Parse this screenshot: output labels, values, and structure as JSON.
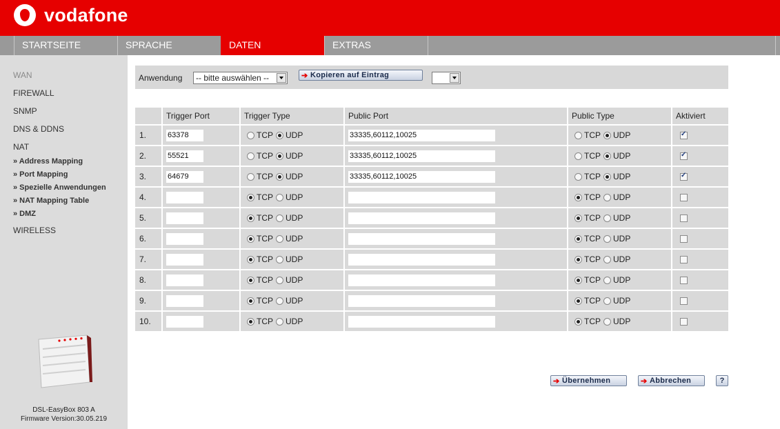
{
  "brand": {
    "name": "vodafone",
    "color": "#e60000"
  },
  "nav": {
    "items": [
      {
        "label": "STARTSEITE",
        "active": false
      },
      {
        "label": "SPRACHE",
        "active": false
      },
      {
        "label": "DATEN",
        "active": true
      },
      {
        "label": "EXTRAS",
        "active": false
      }
    ]
  },
  "sidebar": {
    "items": {
      "wan": "WAN",
      "firewall": "FIREWALL",
      "snmp": "SNMP",
      "dns": "DNS & DDNS",
      "nat": "NAT",
      "wireless": "WIRELESS"
    },
    "nat_sub": {
      "address_mapping": "» Address Mapping",
      "port_mapping": "» Port Mapping",
      "special_apps": "» Spezielle Anwendungen",
      "nat_table": "» NAT Mapping Table",
      "dmz": "» DMZ"
    },
    "device_name": "DSL-EasyBox 803 A",
    "firmware": "Firmware Version:30.05.219"
  },
  "toolbar": {
    "label": "Anwendung",
    "app_select_value": "-- bitte auswählen --",
    "copy_button": "Kopieren auf Eintrag",
    "entry_select_value": ""
  },
  "table": {
    "headers": {
      "num": "",
      "trigger_port": "Trigger Port",
      "trigger_type": "Trigger Type",
      "public_port": "Public Port",
      "public_type": "Public Type",
      "enabled": "Aktiviert"
    },
    "tcp_label": "TCP",
    "udp_label": "UDP",
    "rows": [
      {
        "num": "1.",
        "trigger_port": "63378",
        "trigger_type": "UDP",
        "public_port": "33335,60112,10025",
        "public_type": "UDP",
        "enabled": true
      },
      {
        "num": "2.",
        "trigger_port": "55521",
        "trigger_type": "UDP",
        "public_port": "33335,60112,10025",
        "public_type": "UDP",
        "enabled": true
      },
      {
        "num": "3.",
        "trigger_port": "64679",
        "trigger_type": "UDP",
        "public_port": "33335,60112,10025",
        "public_type": "UDP",
        "enabled": true
      },
      {
        "num": "4.",
        "trigger_port": "",
        "trigger_type": "TCP",
        "public_port": "",
        "public_type": "TCP",
        "enabled": false
      },
      {
        "num": "5.",
        "trigger_port": "",
        "trigger_type": "TCP",
        "public_port": "",
        "public_type": "TCP",
        "enabled": false
      },
      {
        "num": "6.",
        "trigger_port": "",
        "trigger_type": "TCP",
        "public_port": "",
        "public_type": "TCP",
        "enabled": false
      },
      {
        "num": "7.",
        "trigger_port": "",
        "trigger_type": "TCP",
        "public_port": "",
        "public_type": "TCP",
        "enabled": false
      },
      {
        "num": "8.",
        "trigger_port": "",
        "trigger_type": "TCP",
        "public_port": "",
        "public_type": "TCP",
        "enabled": false
      },
      {
        "num": "9.",
        "trigger_port": "",
        "trigger_type": "TCP",
        "public_port": "",
        "public_type": "TCP",
        "enabled": false
      },
      {
        "num": "10.",
        "trigger_port": "",
        "trigger_type": "TCP",
        "public_port": "",
        "public_type": "TCP",
        "enabled": false
      }
    ]
  },
  "actions": {
    "apply": "Übernehmen",
    "cancel": "Abbrechen",
    "help": "?"
  },
  "icons": {
    "logo": "vodafone-speechmark-icon",
    "button_arrow": "arrow-right-icon",
    "device": "router-device-icon"
  }
}
